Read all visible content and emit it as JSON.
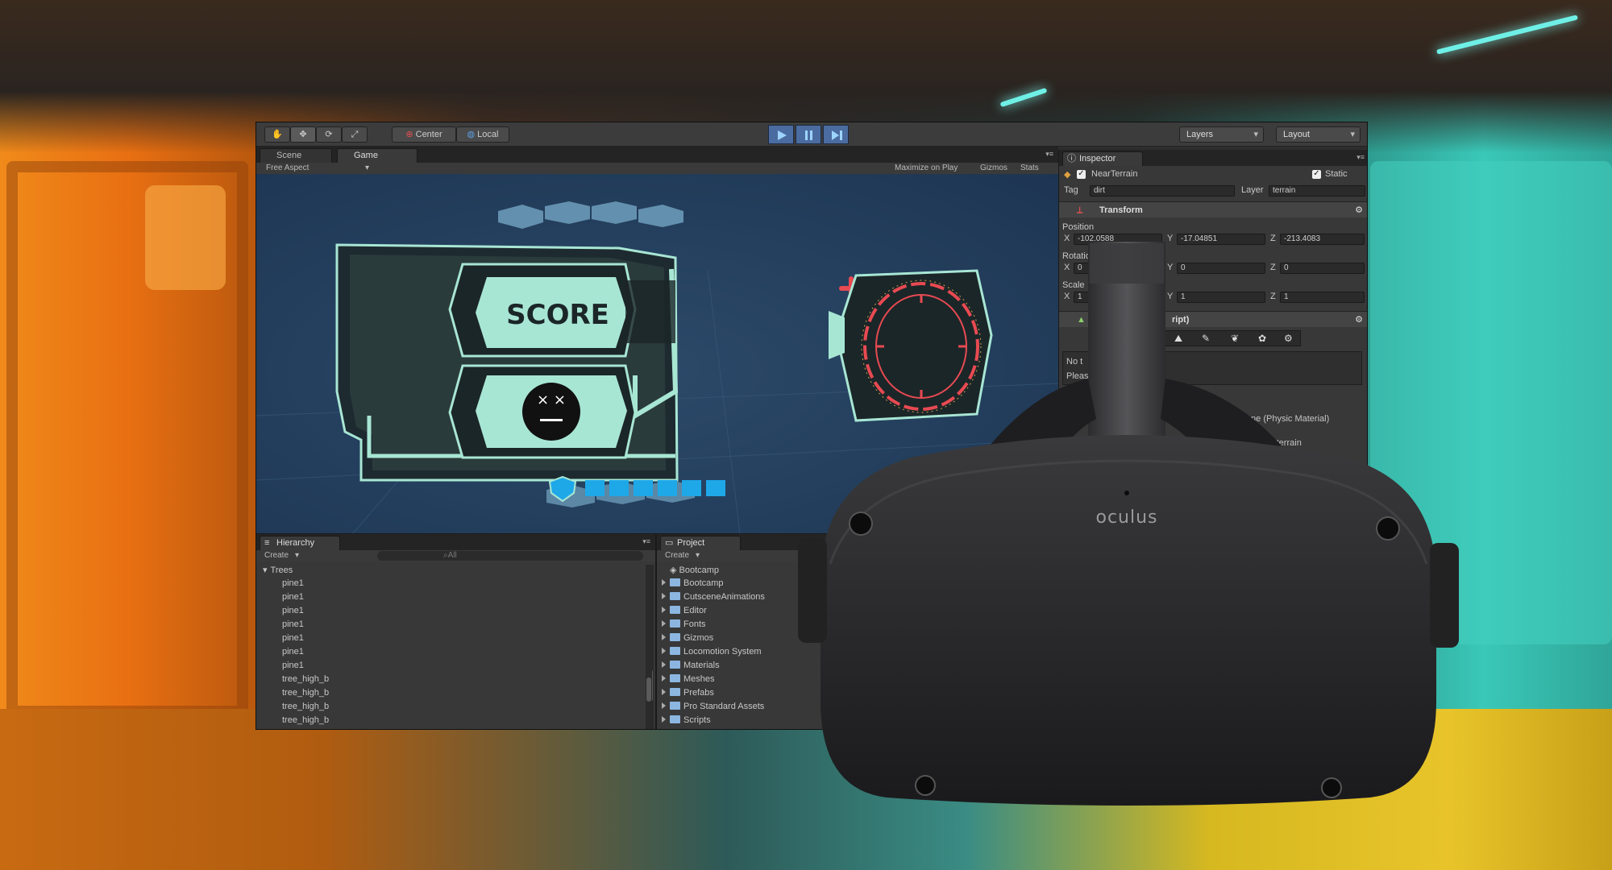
{
  "toolbar": {
    "pivot_center": "Center",
    "pivot_local": "Local",
    "layers": "Layers",
    "layout": "Layout"
  },
  "view_tabs": {
    "scene": "Scene",
    "game": "Game"
  },
  "game_bar": {
    "aspect": "Free Aspect",
    "maximize": "Maximize on Play",
    "gizmos": "Gizmos",
    "stats": "Stats"
  },
  "hud": {
    "score_label": "SCORE",
    "health_cells": 6
  },
  "inspector": {
    "tab": "Inspector",
    "object_name": "NearTerrain",
    "static_label": "Static",
    "tag_label": "Tag",
    "tag_value": "dirt",
    "layer_label": "Layer",
    "layer_value": "terrain",
    "transform_title": "Transform",
    "position_label": "Position",
    "pos": {
      "x": "-102.0588",
      "y": "-17.04851",
      "z": "-213.4083"
    },
    "rotation_label": "Rotatio",
    "rot": {
      "x": "0",
      "y": "0",
      "z": "0"
    },
    "scale_label": "Scale",
    "scale": {
      "x": "1",
      "y": "1",
      "z": "1"
    },
    "script_fragment": "ript)",
    "note1": "No t",
    "note2": "Pleas",
    "physic_material": "None (Physic Material)",
    "terrain_data": "forest_terrain"
  },
  "hierarchy": {
    "tab": "Hierarchy",
    "create": "Create",
    "search": "All",
    "root": "Trees",
    "items": [
      "pine1",
      "pine1",
      "pine1",
      "pine1",
      "pine1",
      "pine1",
      "pine1",
      "tree_high_b",
      "tree_high_b",
      "tree_high_b",
      "tree_high_b"
    ]
  },
  "project": {
    "tab": "Project",
    "create": "Create",
    "items": [
      "Bootcamp",
      "Bootcamp",
      "CutsceneAnimations",
      "Editor",
      "Fonts",
      "Gizmos",
      "Locomotion System",
      "Materials",
      "Meshes",
      "Prefabs",
      "Pro Standard Assets",
      "Scripts"
    ]
  },
  "headset": {
    "brand": "oculus"
  },
  "colors": {
    "hud_teal": "#a8e6d4",
    "hud_red": "#e84a52",
    "hud_blue": "#1ea8e8",
    "play_blue": "#4b6ca0"
  }
}
